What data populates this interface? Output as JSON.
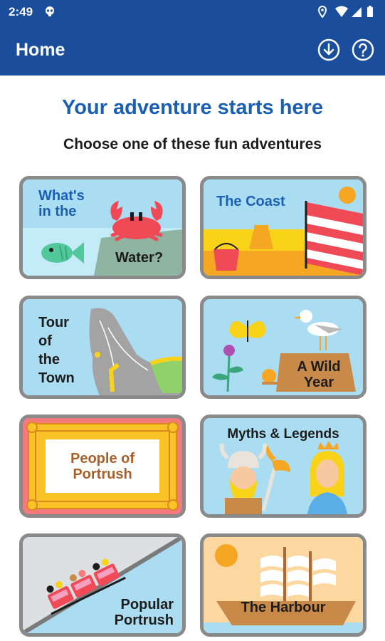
{
  "status_bar": {
    "time": "2:49"
  },
  "app_bar": {
    "title": "Home",
    "download_icon": "download-circle-icon",
    "help_icon": "help-circle-icon"
  },
  "heading": "Your adventure starts here",
  "subheading": "Choose one of these fun adventures",
  "adventures": [
    {
      "label_line1": "What's",
      "label_line2": "in the",
      "label_line3": "Water?"
    },
    {
      "label": "The Coast"
    },
    {
      "label_line1": "Tour",
      "label_line2": "of",
      "label_line3": "the",
      "label_line4": "Town"
    },
    {
      "label_line1": "A Wild",
      "label_line2": "Year"
    },
    {
      "label_line1": "People of",
      "label_line2": "Portrush"
    },
    {
      "label": "Myths & Legends"
    },
    {
      "label_line1": "Popular",
      "label_line2": "Portrush"
    },
    {
      "label": "The Harbour"
    }
  ],
  "colors": {
    "app_bar": "#1a4e9c",
    "heading": "#1a5fb4",
    "card_border": "#8a8a8a",
    "card_sky": "#aadcf2"
  }
}
